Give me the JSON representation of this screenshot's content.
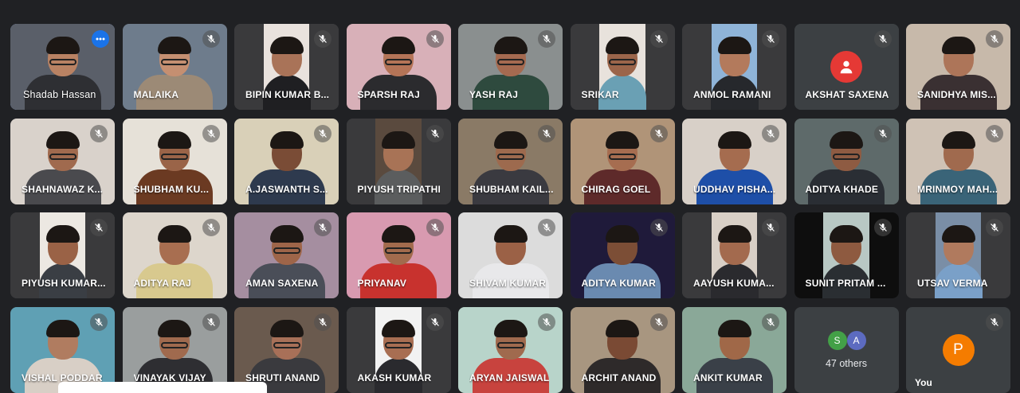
{
  "participants": [
    {
      "name": "Shadab Hassan",
      "bg": "#5a5f69",
      "shirt": "#2e2f33",
      "skin": "#b98263",
      "glasses": true,
      "active": true,
      "menu": true
    },
    {
      "name": "MALAIKA",
      "bg": "#6e7c8c",
      "shirt": "#9c8a76",
      "skin": "#c58f71",
      "glasses": true
    },
    {
      "name": "BIPIN KUMAR B...",
      "bg": "#3a3a3c",
      "panel": "#e9e2dd",
      "shirt": "#1f1f22",
      "skin": "#a97358"
    },
    {
      "name": "SPARSH RAJ",
      "bg": "#d8b0b8",
      "shirt": "#2b2b2e",
      "skin": "#b47457",
      "glasses": true
    },
    {
      "name": "YASH RAJ",
      "bg": "#8a8f8f",
      "shirt": "#2e4a3e",
      "skin": "#a56a50",
      "glasses": true
    },
    {
      "name": "SRIKAR",
      "bg": "#3a3a3c",
      "panel": "#e8e2dc",
      "shirt": "#6aa0b4",
      "skin": "#9b654a",
      "glasses": true
    },
    {
      "name": "ANMOL RAMANI",
      "bg": "#3a3a3c",
      "panel": "#8fb4d8",
      "shirt": "#26282c",
      "skin": "#b37a5c"
    },
    {
      "name": "AKSHAT SAXENA",
      "bg": "#3c4043",
      "avatar": true
    },
    {
      "name": "SANIDHYA MIS...",
      "bg": "#c7b9aa",
      "shirt": "#3a3032",
      "skin": "#ad7559"
    },
    {
      "name": "SHAHNAWAZ K...",
      "bg": "#d9d2cb",
      "shirt": "#4a4a4e",
      "skin": "#a06a4e",
      "glasses": true
    },
    {
      "name": "SHUBHAM KU...",
      "bg": "#e6e1d8",
      "shirt": "#6b3a22",
      "skin": "#9a6448",
      "glasses": true
    },
    {
      "name": "A.JASWANTH S...",
      "bg": "#d9d0b8",
      "shirt": "#2e3a4e",
      "skin": "#7a4c36"
    },
    {
      "name": "PIYUSH TRIPATHI",
      "bg": "#3a3a3c",
      "panel": "#5a4a3e",
      "shirt": "#5b5d5e",
      "skin": "#a87356"
    },
    {
      "name": "SHUBHAM KAIL...",
      "bg": "#8a7a66",
      "shirt": "#3a3a40",
      "skin": "#9d6a4e",
      "glasses": true
    },
    {
      "name": "CHIRAG GOEL",
      "bg": "#b09478",
      "shirt": "#5e2a2a",
      "skin": "#a66d50",
      "glasses": true
    },
    {
      "name": "UDDHAV PISHA...",
      "bg": "#d8d0c8",
      "shirt": "#1e4fa8",
      "skin": "#a56c4f"
    },
    {
      "name": "ADITYA KHADE",
      "bg": "#5e6a6a",
      "shirt": "#2a2e34",
      "skin": "#8e5b42",
      "glasses": true
    },
    {
      "name": "MRINMOY MAH...",
      "bg": "#cfc2b5",
      "shirt": "#3a6478",
      "skin": "#a06a4e"
    },
    {
      "name": "PIYUSH KUMAR...",
      "bg": "#3a3a3c",
      "panel": "#ece8e2",
      "shirt": "#3a3e44",
      "skin": "#9a6246"
    },
    {
      "name": "ADITYA RAJ",
      "bg": "#ddd6cc",
      "shirt": "#d8c98e",
      "skin": "#a86e50"
    },
    {
      "name": "AMAN SAXENA",
      "bg": "#a58ea0",
      "shirt": "#4a4e58",
      "skin": "#9e6549",
      "glasses": true
    },
    {
      "name": "PRIYANAV",
      "bg": "#d89ab0",
      "shirt": "#c8322e",
      "skin": "#a26b4d",
      "glasses": true
    },
    {
      "name": "SHIVAM KUMAR",
      "bg": "#dcdcdc",
      "shirt": "#e8e8ea",
      "skin": "#9b6146"
    },
    {
      "name": "ADITYA KUMAR",
      "bg": "#1f1a3a",
      "shirt": "#6a8ab0",
      "skin": "#7c4e36"
    },
    {
      "name": "AAYUSH KUMA...",
      "bg": "#3a3a3c",
      "panel": "#d8cfc6",
      "shirt": "#2a2a2e",
      "skin": "#a36a4e"
    },
    {
      "name": "SUNIT PRITAM ...",
      "bg": "#0e0e0e",
      "panel": "#b8c8c4",
      "shirt": "#2a2e32",
      "skin": "#8e5a40"
    },
    {
      "name": "UTSAV VERMA",
      "bg": "#3a3a3c",
      "panel": "#7a8ea6",
      "shirt": "#7aa0c8",
      "skin": "#b07a5e"
    },
    {
      "name": "VISHAL PODDAR",
      "bg": "#5fa0b4",
      "shirt": "#d8cfc6",
      "skin": "#b07c60"
    },
    {
      "name": "VINAYAK VIJAY",
      "bg": "#9a9e9e",
      "shirt": "#2e2e32",
      "skin": "#a06a4e",
      "glasses": true
    },
    {
      "name": "SHRUTI ANAND",
      "bg": "#6a5a4e",
      "shirt": "#3a3a3e",
      "skin": "#a87058",
      "glasses": true
    },
    {
      "name": "AKASH KUMAR",
      "bg": "#3a3a3c",
      "panel": "#f2f2f2",
      "shirt": "#2a2a2e",
      "skin": "#a86e52",
      "glasses": true
    },
    {
      "name": "ARYAN JAISWAL",
      "bg": "#b8d4ca",
      "shirt": "#c8433e",
      "skin": "#a06a4e",
      "glasses": true
    },
    {
      "name": "ARCHIT ANAND",
      "bg": "#a89680",
      "shirt": "#2e2a2a",
      "skin": "#7a4a34"
    },
    {
      "name": "ANKIT KUMAR",
      "bg": "#8aa898",
      "shirt": "#3a4048",
      "skin": "#a06848"
    }
  ],
  "akshat_avatar_color": "#e53935",
  "others_tile": {
    "avatars": [
      {
        "letter": "S",
        "color": "#43a047"
      },
      {
        "letter": "A",
        "color": "#5c6bc0"
      }
    ],
    "label": "47 others"
  },
  "self_tile": {
    "avatar_letter": "P",
    "avatar_color": "#f57c00",
    "label": "You"
  },
  "icons": {
    "mute": "mic-off-icon",
    "menu": "more-options-icon"
  }
}
